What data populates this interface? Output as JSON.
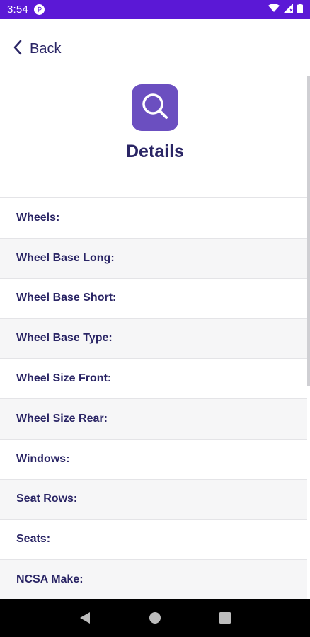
{
  "status_bar": {
    "time": "3:54",
    "app_icon": "app-notification-icon",
    "icons": [
      "wifi-icon",
      "signal-icon",
      "battery-icon"
    ]
  },
  "header": {
    "back_label": "Back",
    "back_icon": "chevron-left-icon",
    "logo_icon": "search-icon",
    "title": "Details"
  },
  "details": {
    "rows": [
      {
        "label": "Wheels:"
      },
      {
        "label": "Wheel Base Long:"
      },
      {
        "label": "Wheel Base Short:"
      },
      {
        "label": "Wheel Base Type:"
      },
      {
        "label": "Wheel Size Front:"
      },
      {
        "label": "Wheel Size Rear:"
      },
      {
        "label": "Windows:"
      },
      {
        "label": "Seat Rows:"
      },
      {
        "label": "Seats:"
      },
      {
        "label": "NCSA Make:"
      }
    ]
  },
  "nav_bar": {
    "buttons": [
      "back-triangle-icon",
      "home-circle-icon",
      "recents-square-icon"
    ]
  },
  "colors": {
    "status_bar": "#5b18d6",
    "accent": "#6b4fc0",
    "text_primary": "#2a2565"
  }
}
